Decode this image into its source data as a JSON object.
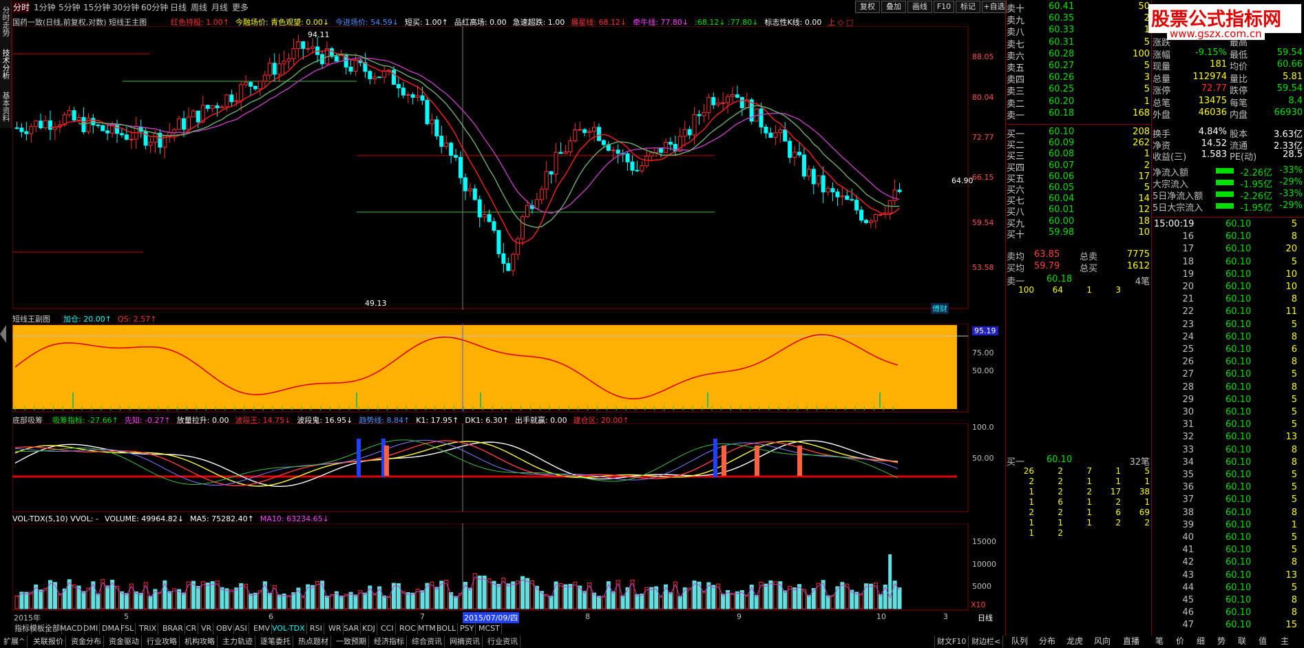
{
  "colors": {
    "up": "#ff3030",
    "down": "#00ffff",
    "panel": "#000000",
    "frame": "#800000",
    "orange": "#ffb000"
  },
  "left_tabs": [
    "分时走势",
    "技术分析",
    "基本资料"
  ],
  "period_tabs": [
    "分时",
    "1分钟",
    "5分钟",
    "15分钟",
    "30分钟",
    "60分钟",
    "日线",
    "周线",
    "月线",
    "更多"
  ],
  "period_selected": "分时",
  "toolbar": [
    "复权",
    "叠加",
    "画线",
    "F10",
    "标记",
    "+自选"
  ],
  "main_title": {
    "name": "国药一致(日线,前复权,对数) 短线王主图",
    "parts": [
      {
        "t": "红色持股: 1.00↑",
        "c": "red"
      },
      {
        "t": "今融场价: 青色观望: 0.00↓",
        "c": "yel"
      },
      {
        "t": "今进场价: 54.59↓",
        "c": "blu"
      },
      {
        "t": "短买: 1.00↑",
        "c": "wht"
      },
      {
        "t": "品红高场: 0.00",
        "c": "wht"
      },
      {
        "t": "急速超跌: 1.00",
        "c": "wht"
      },
      {
        "t": "展星线: 68.12↓",
        "c": "red"
      },
      {
        "t": "牵牛线: 77.80↓",
        "c": "mag"
      },
      {
        "t": ":68.12↓ :77.80↓",
        "c": "grn"
      },
      {
        "t": "标志性K线: 0.00",
        "c": "wht"
      },
      {
        "t": "上 ◇ □",
        "c": "red"
      }
    ]
  },
  "main_price_axis": [
    "88.05",
    "80.04",
    "72.77",
    "66.15",
    "59.54",
    "53.58"
  ],
  "main_labels": {
    "high": "94.11",
    "low": "49.13",
    "last_price": "64.90",
    "logo_text": "傅财",
    "cursor_date": "2015/07/09/四"
  },
  "sub1": {
    "title": "短线王副图",
    "parts": [
      {
        "t": "加仓: 20.00↑",
        "c": "cyn"
      },
      {
        "t": "QS: 2.57↑",
        "c": "red"
      }
    ],
    "axis": [
      "95.19",
      "75.00",
      "50.00"
    ]
  },
  "sub2": {
    "title": "底部吸筹",
    "parts": [
      {
        "t": "吸筹指标: -27.66↑",
        "c": "grn"
      },
      {
        "t": "先知: -0.27↑",
        "c": "mag"
      },
      {
        "t": "放量拉升: 0.00",
        "c": "wht"
      },
      {
        "t": "波段王: 14.75↓",
        "c": "red"
      },
      {
        "t": "波段鬼: 16.95↓",
        "c": "wht"
      },
      {
        "t": "趋势线: 8.84↑",
        "c": "blu"
      },
      {
        "t": "K1: 17.95↑",
        "c": "wht"
      },
      {
        "t": "DK1: 6.30↑",
        "c": "wht"
      },
      {
        "t": "出手就赢: 0.00",
        "c": "wht"
      },
      {
        "t": "建仓区: 20.00↑",
        "c": "red"
      }
    ],
    "axis": [
      "100.0",
      "50.00"
    ]
  },
  "vol": {
    "parts": [
      {
        "t": "VOL-TDX(5,10) VVOL: -",
        "c": "wht"
      },
      {
        "t": "VOLUME: 49964.82↓",
        "c": "wht"
      },
      {
        "t": "MA5: 75282.40↑",
        "c": "wht"
      },
      {
        "t": "MA10: 63234.65↓",
        "c": "mag"
      }
    ],
    "axis": [
      "15000",
      "10000",
      "5000"
    ],
    "unit": "X10"
  },
  "date_axis": [
    "2015年",
    "5",
    "6",
    "7",
    "8",
    "9",
    "10",
    "3",
    "日线"
  ],
  "indicator_tabs": [
    "指标",
    "模板",
    "全部",
    "MACD",
    "DMI",
    "DMA",
    "FSL",
    "TRIX",
    "BRAR",
    "CR",
    "VR",
    "OBV",
    "ASI",
    "EMV",
    "VOL-TDX",
    "RSI",
    "WR",
    "SAR",
    "KDJ",
    "CCI",
    "ROC",
    "MTM",
    "BOLL",
    "PSY",
    "MCST"
  ],
  "bottom_tabs": [
    "扩展^",
    "关联报价",
    "资金分布",
    "资金驱动",
    "行业攻略",
    "机构攻略",
    "主力轨迹",
    "逐笔委托",
    "热点题材",
    "一致预期",
    "经济指标",
    "综合资讯",
    "网摘资讯",
    "行业资讯"
  ],
  "bottom_right": [
    "财文F10",
    "财边栏<"
  ],
  "right_tabs": [
    "队列",
    "分布",
    "龙虎",
    "风向",
    "直播",
    "笔",
    "价",
    "细",
    "势",
    "联",
    "值",
    "主"
  ],
  "watermark": {
    "line1": "股票公式指标网",
    "line2": "www.gszx.com.cn"
  },
  "order_book": {
    "sell": [
      {
        "label": "卖十",
        "price": "60.41",
        "vol": "50"
      },
      {
        "label": "卖九",
        "price": "60.35",
        "vol": "2"
      },
      {
        "label": "卖八",
        "price": "60.33",
        "vol": "1"
      },
      {
        "label": "卖七",
        "price": "60.31",
        "vol": "5"
      },
      {
        "label": "卖六",
        "price": "60.28",
        "vol": "100"
      },
      {
        "label": "卖五",
        "price": "60.27",
        "vol": "5"
      },
      {
        "label": "卖四",
        "price": "60.26",
        "vol": "3"
      },
      {
        "label": "卖三",
        "price": "60.25",
        "vol": "5"
      },
      {
        "label": "卖二",
        "price": "60.20",
        "vol": "1"
      },
      {
        "label": "卖一",
        "price": "60.18",
        "vol": "168"
      }
    ],
    "buy": [
      {
        "label": "买一",
        "price": "60.10",
        "vol": "208"
      },
      {
        "label": "买二",
        "price": "60.09",
        "vol": "262"
      },
      {
        "label": "买三",
        "price": "60.08",
        "vol": "1"
      },
      {
        "label": "买四",
        "price": "60.07",
        "vol": "2"
      },
      {
        "label": "买五",
        "price": "60.06",
        "vol": "17"
      },
      {
        "label": "买六",
        "price": "60.05",
        "vol": "5"
      },
      {
        "label": "买七",
        "price": "60.04",
        "vol": "14"
      },
      {
        "label": "买八",
        "price": "60.01",
        "vol": "12"
      },
      {
        "label": "买九",
        "price": "60.00",
        "vol": "18"
      },
      {
        "label": "买十",
        "price": "59.98",
        "vol": "10"
      }
    ],
    "avg": [
      {
        "l1": "卖均",
        "v1": "63.85",
        "l2": "总卖",
        "v2": "7775"
      },
      {
        "l1": "买均",
        "v1": "59.79",
        "l2": "总买",
        "v2": "1612"
      }
    ],
    "sell1_queue": {
      "label": "卖一",
      "price": "60.18",
      "count": "4笔",
      "items": [
        "100",
        "64",
        "1",
        "3"
      ]
    },
    "buy1_queue": {
      "label": "买一",
      "price": "60.10",
      "count": "32笔",
      "rows": [
        [
          "26",
          "2",
          "7",
          "1",
          "5"
        ],
        [
          "2",
          "2",
          "1",
          "1",
          "1"
        ],
        [
          "1",
          "2",
          "2",
          "17",
          "38"
        ],
        [
          "1",
          "6",
          "1",
          "2",
          "1"
        ],
        [
          "2",
          "2",
          "1",
          "6",
          "69"
        ],
        [
          "1",
          "1",
          "1",
          "2",
          "2"
        ],
        [
          "1",
          "2",
          "",
          "",
          ""
        ]
      ]
    }
  },
  "stats": [
    {
      "l1": "涨跌",
      "v1": "",
      "l2": "最高",
      "v2": ""
    },
    {
      "l1": "涨幅",
      "v1": "-9.15%",
      "l2": "最低",
      "v2": "59.54"
    },
    {
      "l1": "现量",
      "v1": "181",
      "l2": "均价",
      "v2": "60.66"
    },
    {
      "l1": "总量",
      "v1": "112974",
      "l2": "量比",
      "v2": "5.81"
    },
    {
      "l1": "涨停",
      "v1": "72.77",
      "l2": "跌停",
      "v2": "59.54"
    },
    {
      "l1": "总笔",
      "v1": "13475",
      "l2": "每笔",
      "v2": "8.4"
    },
    {
      "l1": "外盘",
      "v1": "46036",
      "l2": "内盘",
      "v2": "66930"
    }
  ],
  "stats2": [
    {
      "l1": "换手",
      "v1": "4.84%",
      "l2": "股本",
      "v2": "3.63亿"
    },
    {
      "l1": "净资",
      "v1": "14.52",
      "l2": "流通",
      "v2": "2.33亿"
    },
    {
      "l1": "收益(三)",
      "v1": "1.583",
      "l2": "PE(动)",
      "v2": "28.5"
    }
  ],
  "flows": [
    {
      "label": "净流入额",
      "value": "-2.26亿",
      "pct": "-33%"
    },
    {
      "label": "大宗流入",
      "value": "-1.95亿",
      "pct": "-29%"
    },
    {
      "label": "5日净流入额",
      "value": "-2.26亿",
      "pct": "-33%"
    },
    {
      "label": "5日大宗流入",
      "value": "-1.95亿",
      "pct": "-29%"
    }
  ],
  "ticks_left": [
    {
      "t": "15:00:19",
      "p": "60.10",
      "v": "5"
    },
    {
      "t": "16",
      "p": "60.10",
      "v": "8"
    },
    {
      "t": "17",
      "p": "60.10",
      "v": "20"
    },
    {
      "t": "18",
      "p": "60.10",
      "v": "5"
    },
    {
      "t": "19",
      "p": "60.10",
      "v": "10"
    },
    {
      "t": "20",
      "p": "60.10",
      "v": "10"
    },
    {
      "t": "21",
      "p": "60.10",
      "v": "8"
    },
    {
      "t": "22",
      "p": "60.10",
      "v": "11"
    },
    {
      "t": "23",
      "p": "60.10",
      "v": "5"
    },
    {
      "t": "24",
      "p": "60.10",
      "v": "8"
    },
    {
      "t": "25",
      "p": "60.10",
      "v": "6"
    },
    {
      "t": "26",
      "p": "60.10",
      "v": "8"
    },
    {
      "t": "27",
      "p": "60.10",
      "v": "5"
    },
    {
      "t": "28",
      "p": "60.10",
      "v": "8"
    },
    {
      "t": "29",
      "p": "60.10",
      "v": "5"
    },
    {
      "t": "30",
      "p": "60.10",
      "v": "5"
    },
    {
      "t": "31",
      "p": "60.10",
      "v": "5"
    },
    {
      "t": "32",
      "p": "60.10",
      "v": "13"
    },
    {
      "t": "33",
      "p": "60.10",
      "v": "8"
    },
    {
      "t": "34",
      "p": "60.10",
      "v": "8"
    },
    {
      "t": "35",
      "p": "60.10",
      "v": "5"
    },
    {
      "t": "36",
      "p": "60.10",
      "v": "5"
    },
    {
      "t": "37",
      "p": "60.10",
      "v": "5"
    },
    {
      "t": "38",
      "p": "60.10",
      "v": "8"
    },
    {
      "t": "39",
      "p": "60.10",
      "v": "1"
    },
    {
      "t": "40",
      "p": "60.10",
      "v": "5"
    },
    {
      "t": "41",
      "p": "60.10",
      "v": "5"
    },
    {
      "t": "42",
      "p": "60.10",
      "v": "8"
    },
    {
      "t": "43",
      "p": "60.10",
      "v": "13"
    },
    {
      "t": "44",
      "p": "60.10",
      "v": "5"
    },
    {
      "t": "45",
      "p": "60.10",
      "v": "8"
    },
    {
      "t": "46",
      "p": "60.10",
      "v": "8"
    },
    {
      "t": "47",
      "p": "60.10",
      "v": "15"
    }
  ]
}
